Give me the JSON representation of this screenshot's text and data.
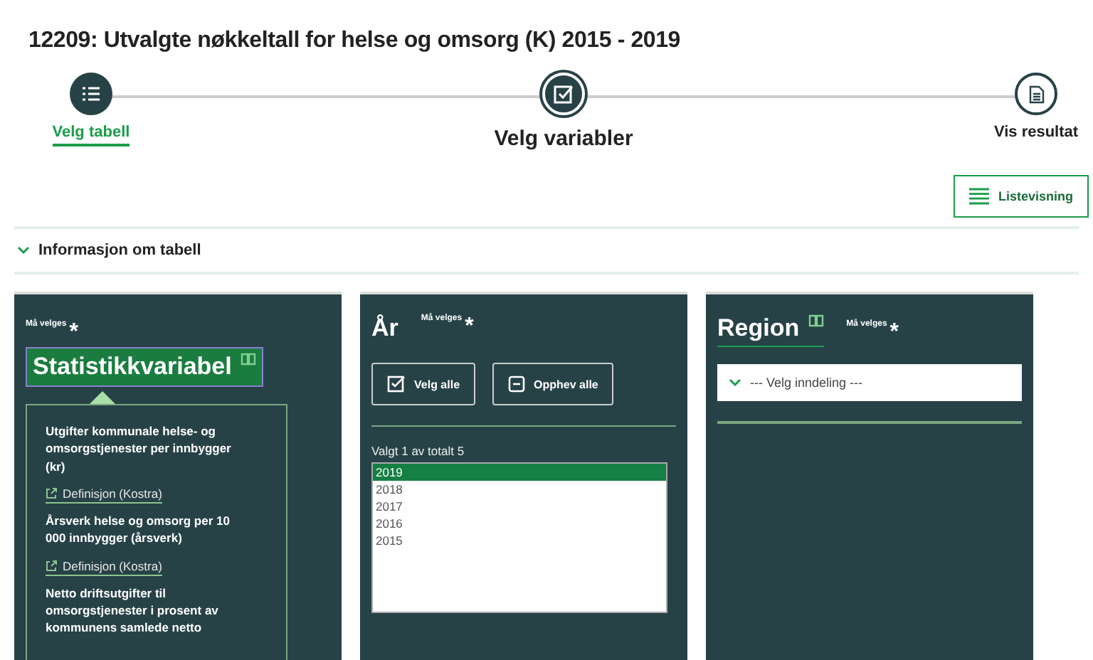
{
  "title": "12209: Utvalgte nøkkeltall for helse og omsorg (K) 2015 - 2019",
  "steps": [
    {
      "label": "Velg tabell",
      "selected": false,
      "completed": true
    },
    {
      "label": "Velg variabler",
      "selected": true,
      "completed": false
    },
    {
      "label": "Vis resultat",
      "selected": false,
      "completed": false
    }
  ],
  "view_button": "Listevisning",
  "info": {
    "label": "Informasjon om tabell",
    "expanded": false
  },
  "panels": {
    "statistic": {
      "required": "Må velges",
      "star": "*",
      "heading": "Statistikkvariabel",
      "variables": [
        {
          "label": "Utgifter kommunale helse- og omsorgstjenester per innbygger (kr)",
          "link": "Definisjon (Kostra)"
        },
        {
          "label": "Årsverk helse og omsorg per 10 000 innbygger (årsverk)",
          "link": "Definisjon (Kostra)"
        },
        {
          "label": "Netto driftsutgifter til omsorgstjenester i prosent av kommunens samlede netto"
        }
      ]
    },
    "year": {
      "heading": "År",
      "required": "Må velges",
      "star": "*",
      "select_all": "Velg alle",
      "deselect_all": "Opphev alle",
      "count": "Valgt 1 av totalt 5",
      "items": [
        {
          "label": "2019",
          "selected": true
        },
        {
          "label": "2018",
          "selected": false
        },
        {
          "label": "2017",
          "selected": false
        },
        {
          "label": "2016",
          "selected": false
        },
        {
          "label": "2015",
          "selected": false
        }
      ]
    },
    "region": {
      "heading": "Region",
      "required": "Må velges",
      "star": "*",
      "dropdown": "--- Velg inndeling ---"
    }
  }
}
